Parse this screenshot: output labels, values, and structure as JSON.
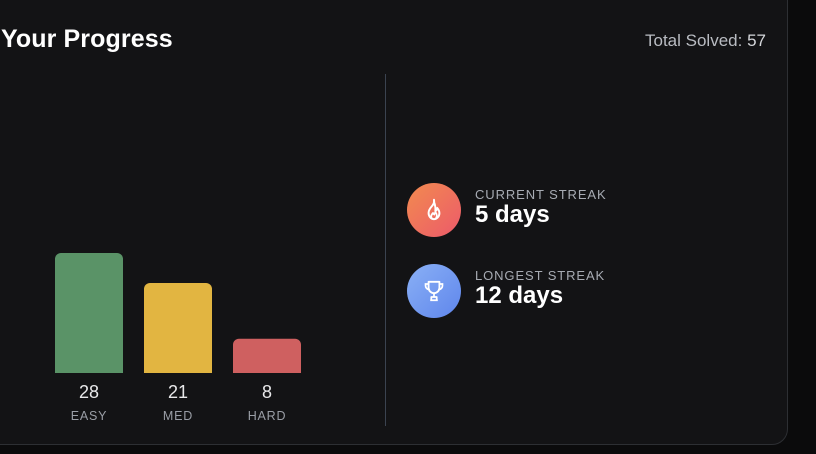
{
  "header": {
    "title": "Your Progress",
    "total_label": "Total Solved:",
    "total_value": "57"
  },
  "chart_data": {
    "type": "bar",
    "categories": [
      "EASY",
      "MED",
      "HARD"
    ],
    "values": [
      28,
      21,
      8
    ],
    "ylim": [
      0,
      28
    ],
    "colors": [
      "#5a9367",
      "#e2b541",
      "#cf6060"
    ]
  },
  "streaks": {
    "current": {
      "label": "CURRENT STREAK",
      "value": "5 days",
      "icon": "flame-icon",
      "colors": [
        "#f28b4f",
        "#ec5a6a"
      ]
    },
    "longest": {
      "label": "LONGEST STREAK",
      "value": "12 days",
      "icon": "trophy-icon",
      "colors": [
        "#8ab0f5",
        "#5f86ec"
      ]
    }
  }
}
